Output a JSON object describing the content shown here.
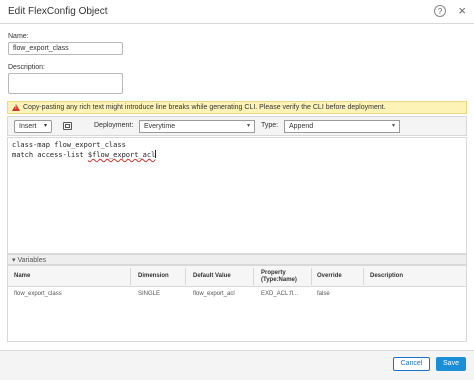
{
  "dialog": {
    "title": "Edit FlexConfig Object",
    "help_label": "?",
    "close_label": "×"
  },
  "form": {
    "name_label": "Name:",
    "name_value": "flow_export_class",
    "description_label": "Description:",
    "description_value": ""
  },
  "warning": {
    "icon": "warning-triangle-icon",
    "text": "Copy-pasting any rich text might introduce line breaks while generating CLI. Please verify the CLI before deployment."
  },
  "toolbar": {
    "insert_label": "Insert",
    "insert_chevron": "▾",
    "deployment_label": "Deployment:",
    "deployment_value": "Everytime",
    "type_label": "Type:",
    "type_value": "Append",
    "select_chevron": "▾"
  },
  "editor": {
    "line1": "class-map flow_export_class",
    "line2_prefix": "match access-list ",
    "line2_var": "$flow_export_acl"
  },
  "variables": {
    "header": "▾ Variables",
    "columns": [
      "Name",
      "Dimension",
      "Default Value",
      "Property (Type:Name)",
      "Override",
      "Description"
    ],
    "rows": [
      [
        "flow_export_class",
        "SINGLE",
        "flow_export_acl",
        "EXD_ACL:fl...",
        "false",
        ""
      ]
    ]
  },
  "footer": {
    "cancel_label": "Cancel",
    "save_label": "Save"
  },
  "colors": {
    "primary": "#1a8fd8",
    "warning_bg": "#fdf3b7",
    "warning_icon": "#d0342c"
  }
}
